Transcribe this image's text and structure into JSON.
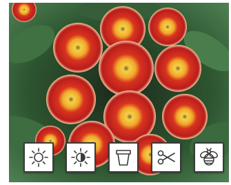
{
  "app": {
    "photo_subject": "",
    "accent": "#3a3a3a"
  },
  "toolbar": {
    "buttons": [
      {
        "id": "full-sun",
        "icon": "sun-icon"
      },
      {
        "id": "partial-sun",
        "icon": "half-sun-icon"
      },
      {
        "id": "container",
        "icon": "pot-icon"
      },
      {
        "id": "pruning",
        "icon": "scissors-icon"
      },
      {
        "id": "pollinators",
        "icon": "bee-icon"
      }
    ]
  },
  "colors": {
    "petal_red": "#c8221f",
    "petal_edge": "#f2c28a",
    "center_yellow": "#f3b62a",
    "leaf_green": "#2f5a33",
    "button_border": "#3a3a3a"
  }
}
